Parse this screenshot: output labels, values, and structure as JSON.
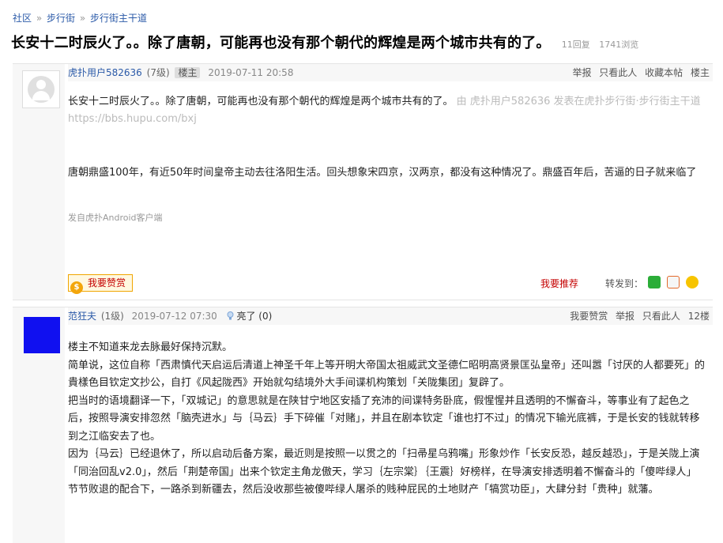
{
  "breadcrumb": {
    "items": [
      "社区",
      "步行街",
      "步行街主干道"
    ],
    "sep": "»"
  },
  "thread": {
    "title": "长安十二时辰火了。。除了唐朝，可能再也没有那个朝代的辉煌是两个城市共有的了。",
    "replies": "11回复",
    "views": "1741浏览"
  },
  "post1": {
    "username": "虎扑用户582636",
    "level": "(7级)",
    "badge": "楼主",
    "time": "2019-07-11 20:58",
    "actions": [
      "举报",
      "只看此人",
      "收藏本帖",
      "楼主"
    ],
    "text1": "长安十二时辰火了。。除了唐朝，可能再也没有那个朝代的辉煌是两个城市共有的了。",
    "source_note": "由 虎扑用户582636 发表在虎扑步行街·步行街主干道 https://bbs.hupu.com/bxj",
    "text2": "唐朝鼎盛100年，有近50年时间皇帝主动去往洛阳生活。回头想象宋四京，汉两京，都没有这种情况了。鼎盛百年后，苦逼的日子就来临了",
    "client": "发自虎扑Android客户端",
    "like_label": "我要赞赏",
    "recommend_label": "我要推荐",
    "share_label": "转发到："
  },
  "post2": {
    "username": "范狂夫",
    "level": "(1级)",
    "time": "2019-07-12 07:30",
    "bright": "亮了 (0)",
    "actions": [
      "我要赞赏",
      "举报",
      "只看此人",
      "12楼"
    ],
    "paragraphs": [
      "楼主不知道来龙去脉最好保持沉默。",
      "简单说，这位自称「西肃慎代天启运后清道上神圣千年上等开明大帝国太祖威武文圣德仁昭明高贤景匡弘皇帝」还叫嚣「讨厌的人都要死」的貴樣色目钦定文抄公，自打《风起陇西》开始就勾结境外大手间谍机构策划「关陇集团」复辟了。",
      "把当时的语境翻译一下，「双城记」的意思就是在陕甘宁地区安插了充沛的间谍特务卧底，假惺惺并且透明的不懈奋斗，等事业有了起色之后，按照导演安排忽然「脑壳进水」与｛马云｝手下碎催「对赌」，并且在剧本钦定「谁也打不过」的情况下输光底裤，于是长安的钱就转移到之江临安去了也。",
      "因为｛马云｝已经退休了，所以启动后备方案，最近则是按照一以贯之的「扫帚星乌鸦嘴」形象炒作「长安反恐，越反越恐」，于是关陇上演「同治回乱v2.0」，然后「荆楚帝国」出来个钦定主角龙傲天，学习｛左宗棠｝｛王震｝好榜样，在导演安排透明着不懈奋斗的「傻哔绿人」节节败退的配合下，一路杀到新疆去，然后没收那些被傻哔绿人屠杀的贱种屁民的土地财产「犒赏功臣」，大肆分封「贵种」就藩。"
    ]
  }
}
